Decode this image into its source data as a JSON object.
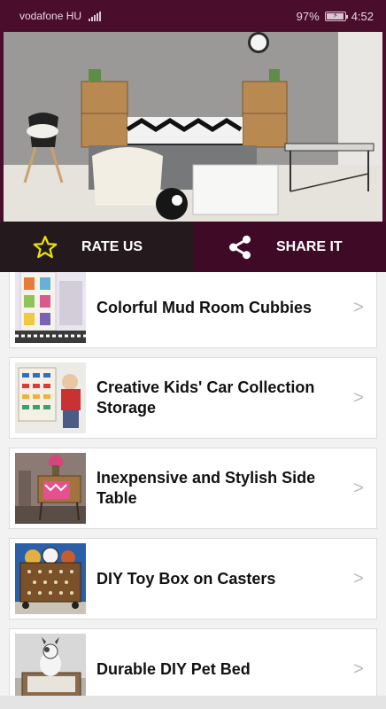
{
  "status_bar": {
    "carrier": "vodafone HU",
    "battery": "97%",
    "battery_level": 0.97,
    "time": "4:52"
  },
  "hero": {
    "image": "bedroom-with-crate-nightstands"
  },
  "actions": {
    "rate": {
      "label": "RATE US",
      "icon": "star-icon"
    },
    "share": {
      "label": "SHARE IT",
      "icon": "share-icon"
    }
  },
  "items": [
    {
      "title": "Colorful Mud Room Cubbies",
      "thumb": "mud-room-cubbies"
    },
    {
      "title": "Creative Kids' Car Collection Storage",
      "thumb": "car-collection"
    },
    {
      "title": "Inexpensive and Stylish Side Table",
      "thumb": "side-table"
    },
    {
      "title": "DIY Toy Box on Casters",
      "thumb": "toy-box"
    },
    {
      "title": "Durable DIY Pet Bed",
      "thumb": "pet-bed"
    }
  ],
  "chevron_glyph": ">",
  "colors": {
    "status_bar": "#4a0d2c",
    "rate_button": "#241a1e",
    "share_button": "#3e0a26",
    "star": "#e8e200"
  }
}
